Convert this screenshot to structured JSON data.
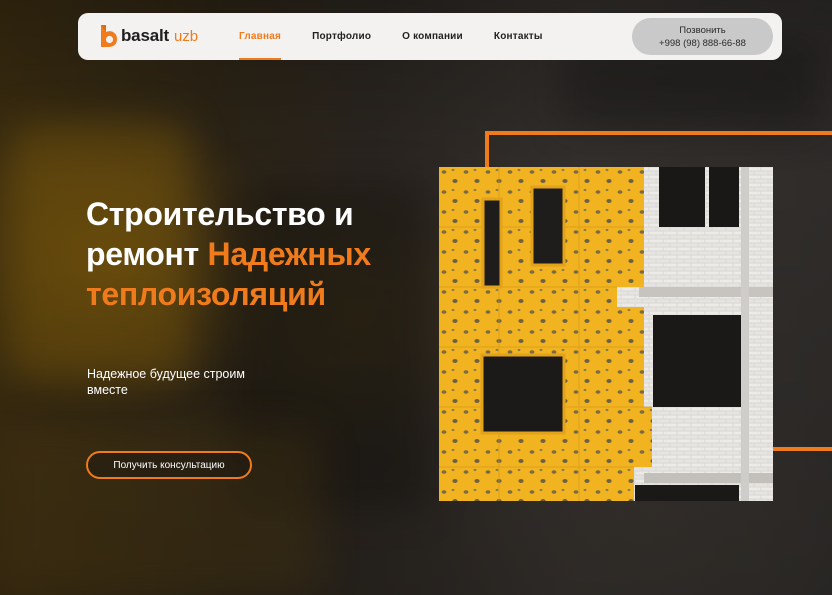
{
  "header": {
    "logo": {
      "brand": "basalt",
      "suffix": "uzb"
    },
    "nav": [
      {
        "label": "Главная",
        "active": true
      },
      {
        "label": "Портфолио",
        "active": false
      },
      {
        "label": "О компании",
        "active": false
      },
      {
        "label": "Контакты",
        "active": false
      }
    ],
    "call": {
      "label": "Позвонить",
      "phone": "+998 (98) 888-66-88"
    }
  },
  "hero": {
    "title_line1": "Строительство и",
    "title_line2_plain": "ремонт ",
    "title_line2_accent": "Надежных",
    "title_line3_accent": "теплоизоляций",
    "subtitle": "Надежное будущее строим вместе",
    "cta_label": "Получить консультацию"
  },
  "image": {
    "icon": "building-insulation-photo"
  },
  "colors": {
    "accent": "#f07b1d",
    "header_bg": "#f3f2f1",
    "call_bg": "#c9c9c9"
  }
}
